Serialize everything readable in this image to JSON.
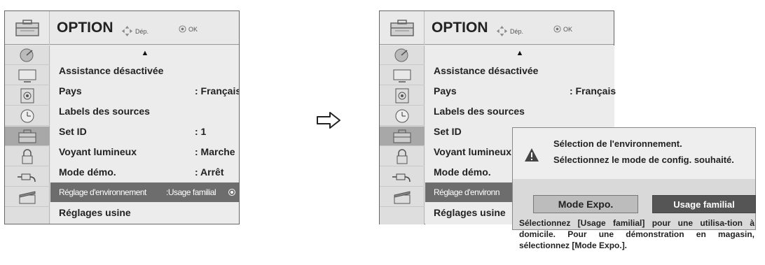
{
  "left_panel": {
    "title": "OPTION",
    "hint_move": "Dép.",
    "hint_ok": "OK",
    "sidebar": [
      {
        "icon": "satellite-dish-icon"
      },
      {
        "icon": "monitor-icon"
      },
      {
        "icon": "speaker-icon"
      },
      {
        "icon": "clock-icon"
      },
      {
        "icon": "option-toolbox-icon",
        "active": true
      },
      {
        "icon": "lock-icon"
      },
      {
        "icon": "input-plug-icon"
      },
      {
        "icon": "clapperboard-icon"
      }
    ],
    "scroll_up": "▲",
    "rows": [
      {
        "label": "Assistance désactivée",
        "value": ""
      },
      {
        "label": "Pays",
        "value": ": Français"
      },
      {
        "label": "Labels des sources",
        "value": ""
      },
      {
        "label": "Set ID",
        "value": ": 1"
      },
      {
        "label": "Voyant lumineux",
        "value": ": Marche"
      },
      {
        "label": "Mode démo.",
        "value": ": Arrêt"
      },
      {
        "label": "Réglage d'environnement",
        "value": ":Usage familial",
        "selected": true
      },
      {
        "label": "Réglages usine",
        "value": ""
      }
    ]
  },
  "transition_arrow": "arrow-right-icon",
  "right_panel": {
    "title": "OPTION",
    "hint_move": "Dép.",
    "hint_ok": "OK",
    "scroll_up": "▲",
    "rows": [
      {
        "label": "Assistance désactivée",
        "value": ""
      },
      {
        "label": "Pays",
        "value": ": Français"
      },
      {
        "label": "Labels des sources",
        "value": ""
      },
      {
        "label": "Set ID",
        "value": ""
      },
      {
        "label": "Voyant lumineux",
        "value": ""
      },
      {
        "label": "Mode démo.",
        "value": ""
      },
      {
        "label": "Réglage d'environn",
        "value": "",
        "selected": true
      },
      {
        "label": "Réglages usine",
        "value": ""
      }
    ],
    "popup": {
      "line1": "Sélection de l'environnement.",
      "line2": "Sélectionnez le mode de config. souhaité.",
      "button_expo": "Mode Expo.",
      "button_home": "Usage familial",
      "description": "Sélectionnez [Usage familial] pour une utilisa-tion à domicile. Pour une démonstration en magasin, sélectionnez [Mode Expo.]."
    }
  },
  "colors": {
    "selected_row": "#6d6d6d",
    "active_sidebar": "#a8a8a8",
    "panel_bg": "#ececec"
  }
}
